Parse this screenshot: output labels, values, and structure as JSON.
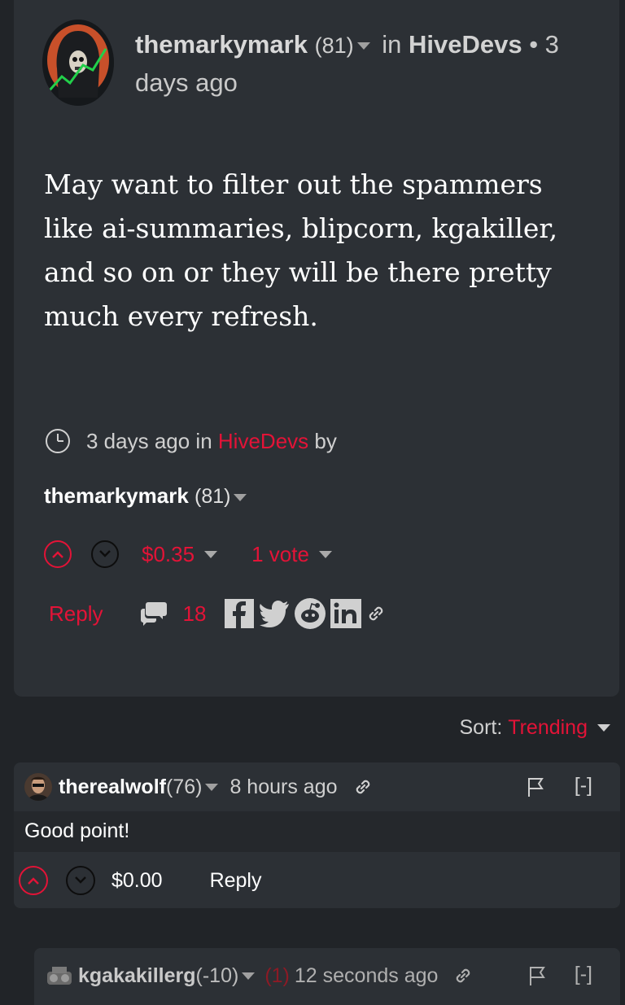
{
  "post": {
    "author": "themarkymark",
    "author_rep": "(81)",
    "in_label": "in",
    "community": "HiveDevs",
    "age_line": "• 3 days ago",
    "body": "May want to filter out the spammers like ai-summaries, blipcorn, kgakiller, and so on or they will be there pretty much every refresh.",
    "meta_time": "3 days ago in",
    "meta_community": "HiveDevs",
    "meta_by": "by",
    "payout": "$0.35",
    "votes": "1 vote",
    "reply_label": "Reply",
    "comment_count": "18"
  },
  "sort": {
    "label": "Sort:",
    "value": "Trending"
  },
  "comments": [
    {
      "author": "therealwolf",
      "rep": "(76)",
      "time": "8 hours ago",
      "body": "Good point!",
      "payout": "$0.00",
      "reply_label": "Reply",
      "collapse": "[-]"
    },
    {
      "author": "kgakakillerg",
      "rep": "(-10)",
      "flag_count": "(1)",
      "time": "12 seconds ago",
      "collapse": "[-]"
    }
  ],
  "colors": {
    "accent": "#e31337",
    "background": "#212428",
    "card": "#2c3035"
  },
  "icons": [
    "clock-icon",
    "upvote-icon",
    "downvote-icon",
    "comment-icon",
    "facebook-icon",
    "twitter-icon",
    "reddit-icon",
    "linkedin-icon",
    "link-icon",
    "flag-icon"
  ]
}
